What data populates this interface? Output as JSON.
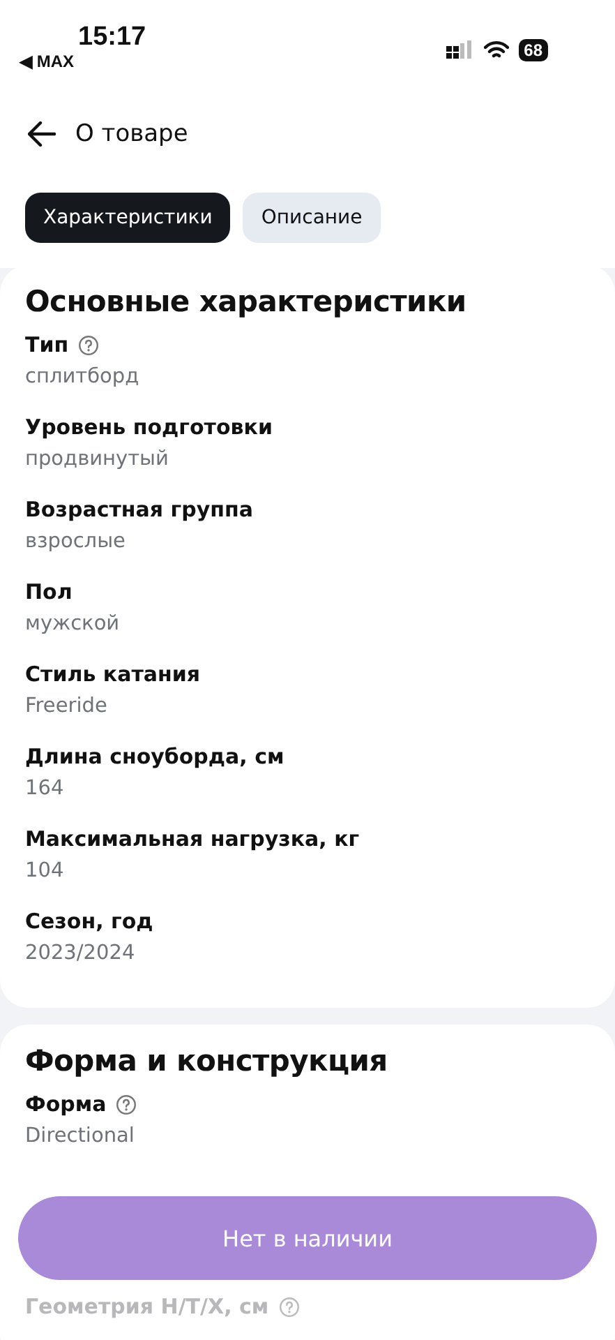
{
  "status_bar": {
    "time": "15:17",
    "back_app": "◀ MAX",
    "battery": "68"
  },
  "header": {
    "title": "О товаре"
  },
  "tabs": [
    {
      "label": "Характеристики",
      "selected": true
    },
    {
      "label": "Описание",
      "selected": false
    }
  ],
  "sections": [
    {
      "title": "Основные характеристики",
      "rows": [
        {
          "label": "Тип",
          "value": "сплитборд",
          "help": true
        },
        {
          "label": "Уровень подготовки",
          "value": "продвинутый",
          "help": false
        },
        {
          "label": "Возрастная группа",
          "value": "взрослые",
          "help": false
        },
        {
          "label": "Пол",
          "value": "мужской",
          "help": false
        },
        {
          "label": "Стиль катания",
          "value": "Freeride",
          "help": false
        },
        {
          "label": "Длина сноуборда, см",
          "value": "164",
          "help": false
        },
        {
          "label": "Максимальная нагрузка, кг",
          "value": "104",
          "help": false
        },
        {
          "label": "Сезон, год",
          "value": "2023/2024",
          "help": false
        }
      ]
    },
    {
      "title": "Форма и конструкция",
      "rows": [
        {
          "label": "Форма",
          "value": "Directional",
          "help": true
        }
      ]
    }
  ],
  "faded_row": {
    "label": "Геометрия Н/Т/Х, см",
    "help": true
  },
  "action_button": {
    "label": "Нет в наличии",
    "disabled": true
  }
}
